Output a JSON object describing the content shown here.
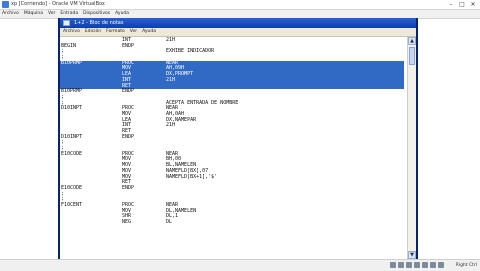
{
  "host_window": {
    "title": "xp [Corriendo] - Oracle VM VirtualBox",
    "controls": [
      "–",
      "□",
      "✕"
    ],
    "menu": [
      "Archivo",
      "Máquina",
      "Ver",
      "Entrada",
      "Dispositivos",
      "Ayuda"
    ]
  },
  "notepad": {
    "title": "1+2 - Bloc de notas",
    "menu": [
      "Archivo",
      "Edición",
      "Formato",
      "Ver",
      "Ayuda"
    ],
    "selection_color": "#316ac5",
    "lines": [
      {
        "c0": "",
        "c1": "INT",
        "c2": "21H",
        "sel": false
      },
      {
        "c0": "BEGIN",
        "c1": "ENDP",
        "c2": "",
        "sel": false
      },
      {
        "c0": ";",
        "c1": "",
        "c2": "EXHIBE INDICADOR",
        "sel": false
      },
      {
        "c0": ";",
        "c1": "",
        "c2": "",
        "sel": false
      },
      {
        "c0": "B10PRMP",
        "c1": "PROC",
        "c2": "NEAR",
        "sel": true
      },
      {
        "c0": "",
        "c1": "MOV",
        "c2": "AH,09H",
        "sel": true
      },
      {
        "c0": "",
        "c1": "LEA",
        "c2": "DX,PROMPT",
        "sel": true
      },
      {
        "c0": "",
        "c1": "INT",
        "c2": "21H",
        "sel": true
      },
      {
        "c0": "",
        "c1": "RET",
        "c2": "",
        "sel": true
      },
      {
        "c0": "B10PRMP",
        "c1": "ENDP",
        "c2": "",
        "sel": false
      },
      {
        "c0": ";",
        "c1": "",
        "c2": "",
        "sel": false
      },
      {
        "c0": ";",
        "c1": "",
        "c2": "ACEPTA ENTRADA DE NOMBRE",
        "sel": false
      },
      {
        "c0": "D10INPT",
        "c1": "PROC",
        "c2": "NEAR",
        "sel": false
      },
      {
        "c0": "",
        "c1": "MOV",
        "c2": "AH,0AH",
        "sel": false
      },
      {
        "c0": "",
        "c1": "LEA",
        "c2": "DX,NAMEPAR",
        "sel": false
      },
      {
        "c0": "",
        "c1": "INT",
        "c2": "21H",
        "sel": false
      },
      {
        "c0": "",
        "c1": "RET",
        "c2": "",
        "sel": false
      },
      {
        "c0": "D10INPT",
        "c1": "ENDP",
        "c2": "",
        "sel": false
      },
      {
        "c0": ";",
        "c1": "",
        "c2": "",
        "sel": false
      },
      {
        "c0": ";",
        "c1": "",
        "c2": "",
        "sel": false
      },
      {
        "c0": "E10CODE",
        "c1": "PROC",
        "c2": "NEAR",
        "sel": false
      },
      {
        "c0": "",
        "c1": "MOV",
        "c2": "BH,00",
        "sel": false
      },
      {
        "c0": "",
        "c1": "MOV",
        "c2": "BL,NAMELEN",
        "sel": false
      },
      {
        "c0": "",
        "c1": "MOV",
        "c2": "NAMEFLD[BX],07",
        "sel": false
      },
      {
        "c0": "",
        "c1": "MOV",
        "c2": "NAMEFLD[BX+1],'$'",
        "sel": false
      },
      {
        "c0": "",
        "c1": "RET",
        "c2": "",
        "sel": false
      },
      {
        "c0": "E10CODE",
        "c1": "ENDP",
        "c2": "",
        "sel": false
      },
      {
        "c0": ";",
        "c1": "",
        "c2": "",
        "sel": false
      },
      {
        "c0": ";",
        "c1": "",
        "c2": "",
        "sel": false
      },
      {
        "c0": "F10CENT",
        "c1": "PROC",
        "c2": "NEAR",
        "sel": false
      },
      {
        "c0": "",
        "c1": "MOV",
        "c2": "DL,NAMELEN",
        "sel": false
      },
      {
        "c0": "",
        "c1": "SHR",
        "c2": "DL,1",
        "sel": false
      },
      {
        "c0": "",
        "c1": "NEG",
        "c2": "DL",
        "sel": false
      }
    ]
  },
  "status_bar": {
    "host_key": "Right Ctrl"
  }
}
